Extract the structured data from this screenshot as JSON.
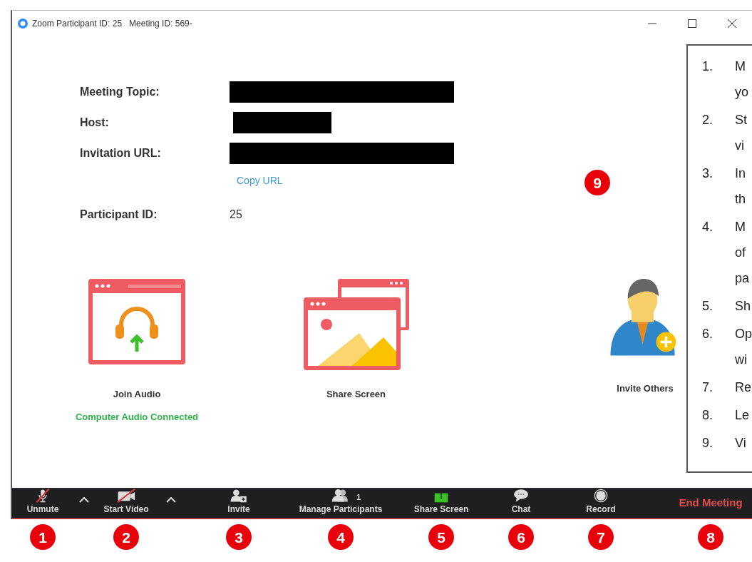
{
  "window": {
    "title": "Zoom Participant ID: 25   Meeting ID: 569-"
  },
  "info": [
    {
      "label": "Meeting Topic:",
      "kind": "wide_redaction"
    },
    {
      "label": "Host:",
      "kind": "narrow_redaction"
    },
    {
      "label": "Invitation URL:",
      "kind": "wide_redaction",
      "link": "Copy URL"
    },
    {
      "label": "Participant ID:",
      "kind": "text",
      "value": "25"
    }
  ],
  "actions": [
    {
      "label": "Join Audio",
      "kind": "audio",
      "status": "Computer Audio Connected"
    },
    {
      "label": "Share Screen",
      "kind": "share"
    },
    {
      "label": "Invite Others",
      "kind": "invite"
    }
  ],
  "canvas_badge": "9",
  "toolbar": [
    {
      "label": "Unmute",
      "kind": "mic",
      "off": true,
      "caret": true,
      "badge": "1"
    },
    {
      "label": "Start Video",
      "kind": "video",
      "off": true,
      "caret": true,
      "badge": "2"
    },
    {
      "label": "Invite",
      "kind": "invite",
      "off": false,
      "caret": false,
      "badge": "3"
    },
    {
      "label": "Manage Participants",
      "kind": "participants",
      "off": false,
      "caret": false,
      "count": "1",
      "badge": "4"
    },
    {
      "label": "Share Screen",
      "kind": "share",
      "off": false,
      "caret": false,
      "badge": "5"
    },
    {
      "label": "Chat",
      "kind": "chat",
      "off": false,
      "caret": false,
      "badge": "6"
    },
    {
      "label": "Record",
      "kind": "record",
      "off": false,
      "caret": false,
      "badge": "7"
    },
    {
      "label": "End Meeting",
      "kind": "end",
      "off": false,
      "caret": false,
      "badge": "8"
    }
  ],
  "legend": [
    {
      "number": "1.",
      "lines": [
        "M",
        "yo"
      ]
    },
    {
      "number": "2.",
      "lines": [
        "St",
        "vi"
      ]
    },
    {
      "number": "3.",
      "lines": [
        "In",
        "th"
      ]
    },
    {
      "number": "4.",
      "lines": [
        "M",
        "of",
        "pa"
      ]
    },
    {
      "number": "5.",
      "lines": [
        "Sh"
      ]
    },
    {
      "number": "6.",
      "lines": [
        "Op",
        "wi"
      ]
    },
    {
      "number": "7.",
      "lines": [
        "Re"
      ]
    },
    {
      "number": "8.",
      "lines": [
        "Le"
      ]
    },
    {
      "number": "9.",
      "lines": [
        "Vi"
      ]
    }
  ]
}
